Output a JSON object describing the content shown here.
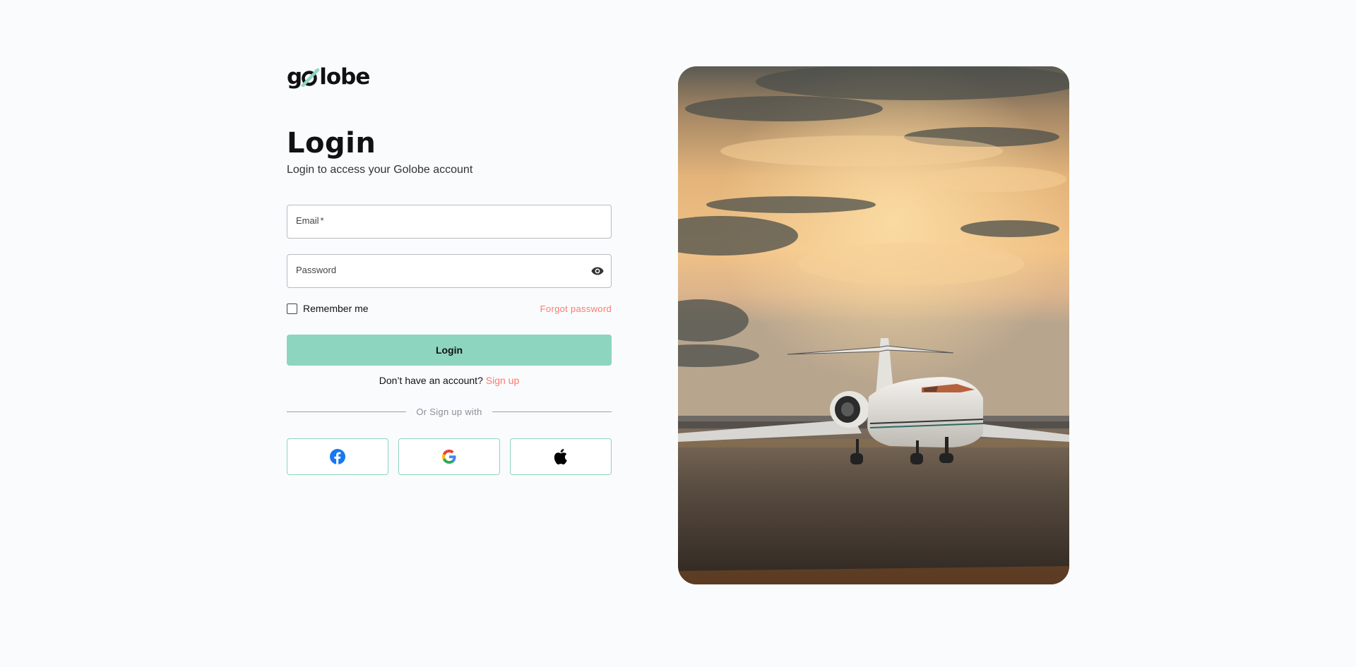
{
  "brand": {
    "logo_text_start": "g",
    "logo_text_end": "lobe",
    "accent_color": "#8ed5bf",
    "link_color": "#ff7a6b"
  },
  "header": {
    "title": "Login",
    "subtitle": "Login to access your Golobe account"
  },
  "form": {
    "email_label": "Email",
    "email_required_mark": "*",
    "email_value": "",
    "password_label": "Password",
    "password_value": "",
    "password_toggle_icon": "eye-icon",
    "remember_label": "Remember me",
    "remember_checked": false,
    "forgot_label": "Forgot password",
    "submit_label": "Login"
  },
  "signup": {
    "prompt": "Don’t have an account?",
    "link_label": "Sign up"
  },
  "divider": {
    "text": "Or Sign up with"
  },
  "socials": [
    {
      "name": "facebook",
      "icon": "facebook-icon"
    },
    {
      "name": "google",
      "icon": "google-icon"
    },
    {
      "name": "apple",
      "icon": "apple-icon"
    }
  ],
  "hero": {
    "image": "private-jet-on-runway-at-sunset"
  }
}
